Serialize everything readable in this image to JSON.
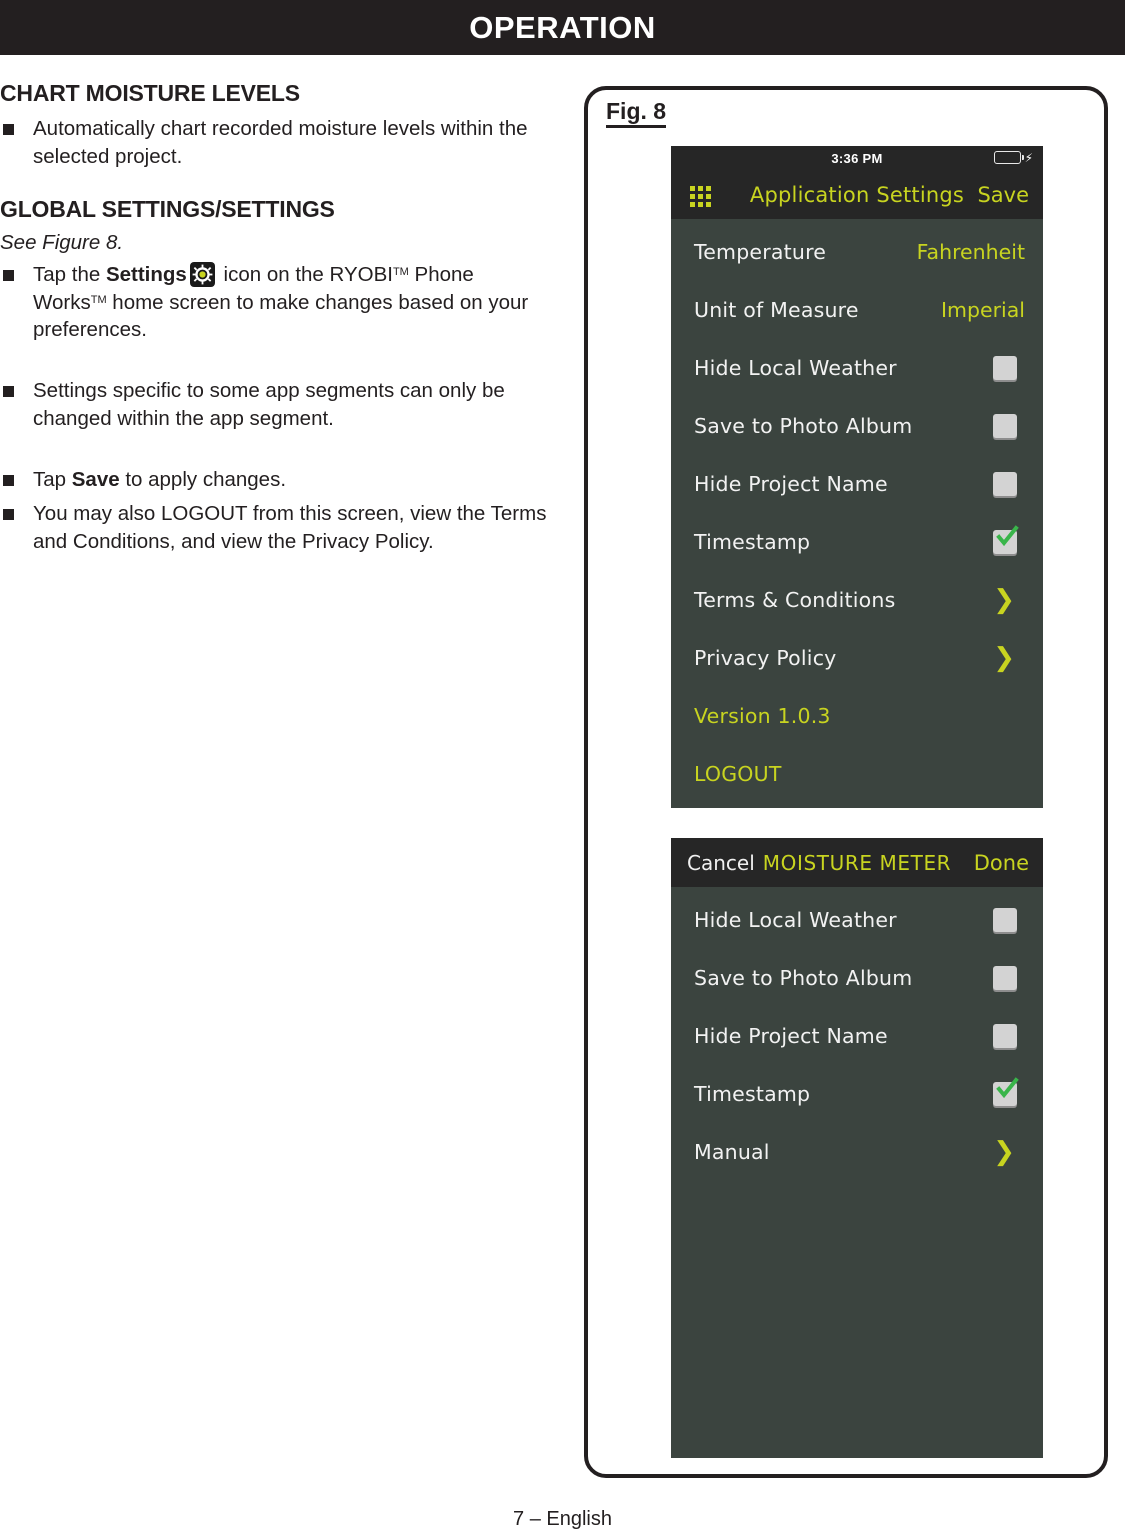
{
  "page": {
    "banner_title": "OPERATION",
    "footer": "7 – English"
  },
  "content": {
    "heading_1": "CHART MOISTURE LEVELS",
    "bullet_1": "Automatically chart recorded moisture levels within the selected project.",
    "heading_2": "GLOBAL SETTINGS/SETTINGS",
    "see_figure": "See Figure 8.",
    "bullet_2_part1": "Tap the ",
    "bullet_2_bold": "Settings",
    "bullet_2_part2": " icon on the RYOBI",
    "bullet_2_tm1": "TM",
    "bullet_2_part3": " Phone Works",
    "bullet_2_tm2": "TM",
    "bullet_2_part4": " home screen to make changes based on your preferences.",
    "bullet_3": "Settings specific to some app segments can only be changed within the app segment.",
    "bullet_4_part1": "Tap ",
    "bullet_4_bold": "Save",
    "bullet_4_part2": " to apply changes.",
    "bullet_5": "You may also LOGOUT from this screen, view the Terms and Conditions, and view the Privacy Policy.",
    "gear_icon_name": "settings-gear-icon"
  },
  "figure": {
    "label": "Fig. 8"
  },
  "screen1": {
    "status": {
      "time": "3:36 PM",
      "battery_icon": "battery-charging-icon"
    },
    "navbar": {
      "grid_icon": "grid-menu-icon",
      "title": "Application Settings",
      "right_action": "Save"
    },
    "rows": [
      {
        "label": "Temperature",
        "type": "value",
        "value": "Fahrenheit"
      },
      {
        "label": "Unit of Measure",
        "type": "value",
        "value": "Imperial"
      },
      {
        "label": "Hide Local Weather",
        "type": "checkbox",
        "checked": false
      },
      {
        "label": "Save to Photo Album",
        "type": "checkbox",
        "checked": false
      },
      {
        "label": "Hide Project Name",
        "type": "checkbox",
        "checked": false
      },
      {
        "label": "Timestamp",
        "type": "checkbox",
        "checked": true
      },
      {
        "label": "Terms & Conditions",
        "type": "chevron"
      },
      {
        "label": "Privacy Policy",
        "type": "chevron"
      },
      {
        "label": "Version 1.0.3",
        "type": "accent"
      },
      {
        "label": "LOGOUT",
        "type": "accent"
      }
    ]
  },
  "screen2": {
    "navbar": {
      "left_action": "Cancel",
      "title": "MOISTURE METER",
      "right_action": "Done"
    },
    "rows": [
      {
        "label": "Hide Local Weather",
        "type": "checkbox",
        "checked": false
      },
      {
        "label": "Save to Photo Album",
        "type": "checkbox",
        "checked": false
      },
      {
        "label": "Hide Project Name",
        "type": "checkbox",
        "checked": false
      },
      {
        "label": "Timestamp",
        "type": "checkbox",
        "checked": true
      },
      {
        "label": "Manual",
        "type": "chevron"
      }
    ]
  },
  "colors": {
    "accent": "#c8d420",
    "banner": "#231f20",
    "list_bg": "#3b443f",
    "navbar_bg": "#262626",
    "check_green": "#39b54a",
    "battery_green": "#4cd964"
  }
}
